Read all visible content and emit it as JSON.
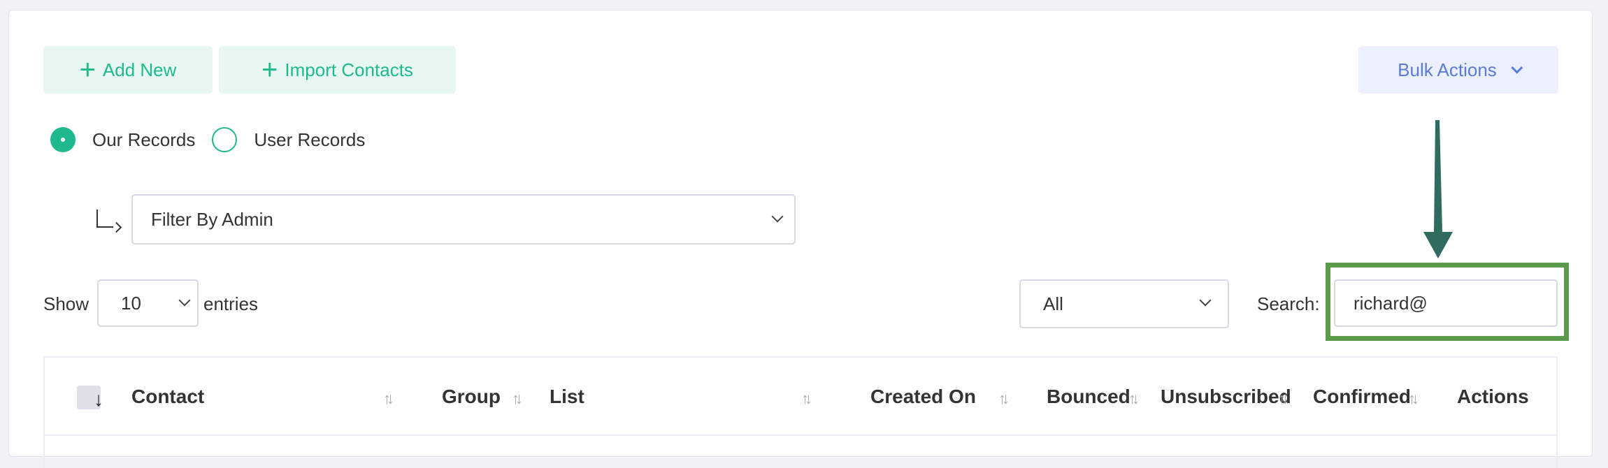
{
  "toolbar": {
    "add_new": "Add New",
    "import_contacts": "Import Contacts",
    "bulk_actions": "Bulk Actions"
  },
  "record_filter": {
    "options": [
      {
        "label": "Our Records",
        "selected": true
      },
      {
        "label": "User Records",
        "selected": false
      }
    ]
  },
  "admin_filter": {
    "value": "Filter By Admin"
  },
  "entries": {
    "show_label": "Show",
    "value": "10",
    "suffix": "entries"
  },
  "status_filter": {
    "value": "All"
  },
  "search": {
    "label": "Search:",
    "value": "richard@"
  },
  "table": {
    "columns": [
      "Contact",
      "Group",
      "List",
      "Created On",
      "Bounced",
      "Unsubscribed",
      "Confirmed",
      "Actions"
    ]
  },
  "colors": {
    "accent": "#1eb98f",
    "bulk": "#5a7bd8",
    "annotation_arrow": "#2f6b5e",
    "annotation_box": "#5c9a4b"
  }
}
